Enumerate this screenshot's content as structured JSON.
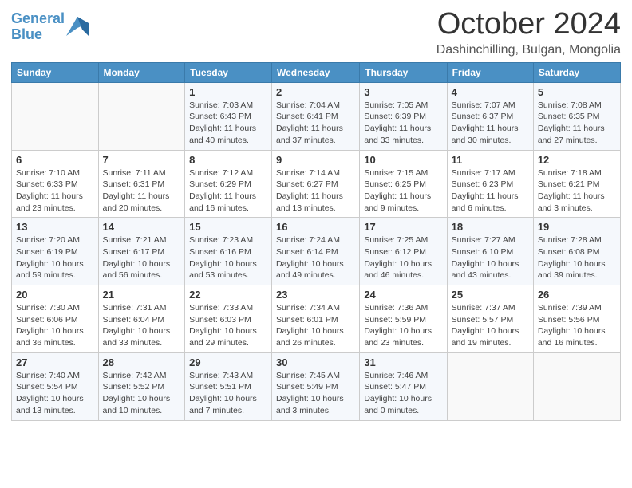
{
  "header": {
    "title": "October 2024",
    "subtitle": "Dashinchilling, Bulgan, Mongolia"
  },
  "weekdays": [
    "Sunday",
    "Monday",
    "Tuesday",
    "Wednesday",
    "Thursday",
    "Friday",
    "Saturday"
  ],
  "rows": [
    [
      {
        "day": "",
        "sunrise": "",
        "sunset": "",
        "daylight": ""
      },
      {
        "day": "",
        "sunrise": "",
        "sunset": "",
        "daylight": ""
      },
      {
        "day": "1",
        "sunrise": "Sunrise: 7:03 AM",
        "sunset": "Sunset: 6:43 PM",
        "daylight": "Daylight: 11 hours and 40 minutes."
      },
      {
        "day": "2",
        "sunrise": "Sunrise: 7:04 AM",
        "sunset": "Sunset: 6:41 PM",
        "daylight": "Daylight: 11 hours and 37 minutes."
      },
      {
        "day": "3",
        "sunrise": "Sunrise: 7:05 AM",
        "sunset": "Sunset: 6:39 PM",
        "daylight": "Daylight: 11 hours and 33 minutes."
      },
      {
        "day": "4",
        "sunrise": "Sunrise: 7:07 AM",
        "sunset": "Sunset: 6:37 PM",
        "daylight": "Daylight: 11 hours and 30 minutes."
      },
      {
        "day": "5",
        "sunrise": "Sunrise: 7:08 AM",
        "sunset": "Sunset: 6:35 PM",
        "daylight": "Daylight: 11 hours and 27 minutes."
      }
    ],
    [
      {
        "day": "6",
        "sunrise": "Sunrise: 7:10 AM",
        "sunset": "Sunset: 6:33 PM",
        "daylight": "Daylight: 11 hours and 23 minutes."
      },
      {
        "day": "7",
        "sunrise": "Sunrise: 7:11 AM",
        "sunset": "Sunset: 6:31 PM",
        "daylight": "Daylight: 11 hours and 20 minutes."
      },
      {
        "day": "8",
        "sunrise": "Sunrise: 7:12 AM",
        "sunset": "Sunset: 6:29 PM",
        "daylight": "Daylight: 11 hours and 16 minutes."
      },
      {
        "day": "9",
        "sunrise": "Sunrise: 7:14 AM",
        "sunset": "Sunset: 6:27 PM",
        "daylight": "Daylight: 11 hours and 13 minutes."
      },
      {
        "day": "10",
        "sunrise": "Sunrise: 7:15 AM",
        "sunset": "Sunset: 6:25 PM",
        "daylight": "Daylight: 11 hours and 9 minutes."
      },
      {
        "day": "11",
        "sunrise": "Sunrise: 7:17 AM",
        "sunset": "Sunset: 6:23 PM",
        "daylight": "Daylight: 11 hours and 6 minutes."
      },
      {
        "day": "12",
        "sunrise": "Sunrise: 7:18 AM",
        "sunset": "Sunset: 6:21 PM",
        "daylight": "Daylight: 11 hours and 3 minutes."
      }
    ],
    [
      {
        "day": "13",
        "sunrise": "Sunrise: 7:20 AM",
        "sunset": "Sunset: 6:19 PM",
        "daylight": "Daylight: 10 hours and 59 minutes."
      },
      {
        "day": "14",
        "sunrise": "Sunrise: 7:21 AM",
        "sunset": "Sunset: 6:17 PM",
        "daylight": "Daylight: 10 hours and 56 minutes."
      },
      {
        "day": "15",
        "sunrise": "Sunrise: 7:23 AM",
        "sunset": "Sunset: 6:16 PM",
        "daylight": "Daylight: 10 hours and 53 minutes."
      },
      {
        "day": "16",
        "sunrise": "Sunrise: 7:24 AM",
        "sunset": "Sunset: 6:14 PM",
        "daylight": "Daylight: 10 hours and 49 minutes."
      },
      {
        "day": "17",
        "sunrise": "Sunrise: 7:25 AM",
        "sunset": "Sunset: 6:12 PM",
        "daylight": "Daylight: 10 hours and 46 minutes."
      },
      {
        "day": "18",
        "sunrise": "Sunrise: 7:27 AM",
        "sunset": "Sunset: 6:10 PM",
        "daylight": "Daylight: 10 hours and 43 minutes."
      },
      {
        "day": "19",
        "sunrise": "Sunrise: 7:28 AM",
        "sunset": "Sunset: 6:08 PM",
        "daylight": "Daylight: 10 hours and 39 minutes."
      }
    ],
    [
      {
        "day": "20",
        "sunrise": "Sunrise: 7:30 AM",
        "sunset": "Sunset: 6:06 PM",
        "daylight": "Daylight: 10 hours and 36 minutes."
      },
      {
        "day": "21",
        "sunrise": "Sunrise: 7:31 AM",
        "sunset": "Sunset: 6:04 PM",
        "daylight": "Daylight: 10 hours and 33 minutes."
      },
      {
        "day": "22",
        "sunrise": "Sunrise: 7:33 AM",
        "sunset": "Sunset: 6:03 PM",
        "daylight": "Daylight: 10 hours and 29 minutes."
      },
      {
        "day": "23",
        "sunrise": "Sunrise: 7:34 AM",
        "sunset": "Sunset: 6:01 PM",
        "daylight": "Daylight: 10 hours and 26 minutes."
      },
      {
        "day": "24",
        "sunrise": "Sunrise: 7:36 AM",
        "sunset": "Sunset: 5:59 PM",
        "daylight": "Daylight: 10 hours and 23 minutes."
      },
      {
        "day": "25",
        "sunrise": "Sunrise: 7:37 AM",
        "sunset": "Sunset: 5:57 PM",
        "daylight": "Daylight: 10 hours and 19 minutes."
      },
      {
        "day": "26",
        "sunrise": "Sunrise: 7:39 AM",
        "sunset": "Sunset: 5:56 PM",
        "daylight": "Daylight: 10 hours and 16 minutes."
      }
    ],
    [
      {
        "day": "27",
        "sunrise": "Sunrise: 7:40 AM",
        "sunset": "Sunset: 5:54 PM",
        "daylight": "Daylight: 10 hours and 13 minutes."
      },
      {
        "day": "28",
        "sunrise": "Sunrise: 7:42 AM",
        "sunset": "Sunset: 5:52 PM",
        "daylight": "Daylight: 10 hours and 10 minutes."
      },
      {
        "day": "29",
        "sunrise": "Sunrise: 7:43 AM",
        "sunset": "Sunset: 5:51 PM",
        "daylight": "Daylight: 10 hours and 7 minutes."
      },
      {
        "day": "30",
        "sunrise": "Sunrise: 7:45 AM",
        "sunset": "Sunset: 5:49 PM",
        "daylight": "Daylight: 10 hours and 3 minutes."
      },
      {
        "day": "31",
        "sunrise": "Sunrise: 7:46 AM",
        "sunset": "Sunset: 5:47 PM",
        "daylight": "Daylight: 10 hours and 0 minutes."
      },
      {
        "day": "",
        "sunrise": "",
        "sunset": "",
        "daylight": ""
      },
      {
        "day": "",
        "sunrise": "",
        "sunset": "",
        "daylight": ""
      }
    ]
  ]
}
